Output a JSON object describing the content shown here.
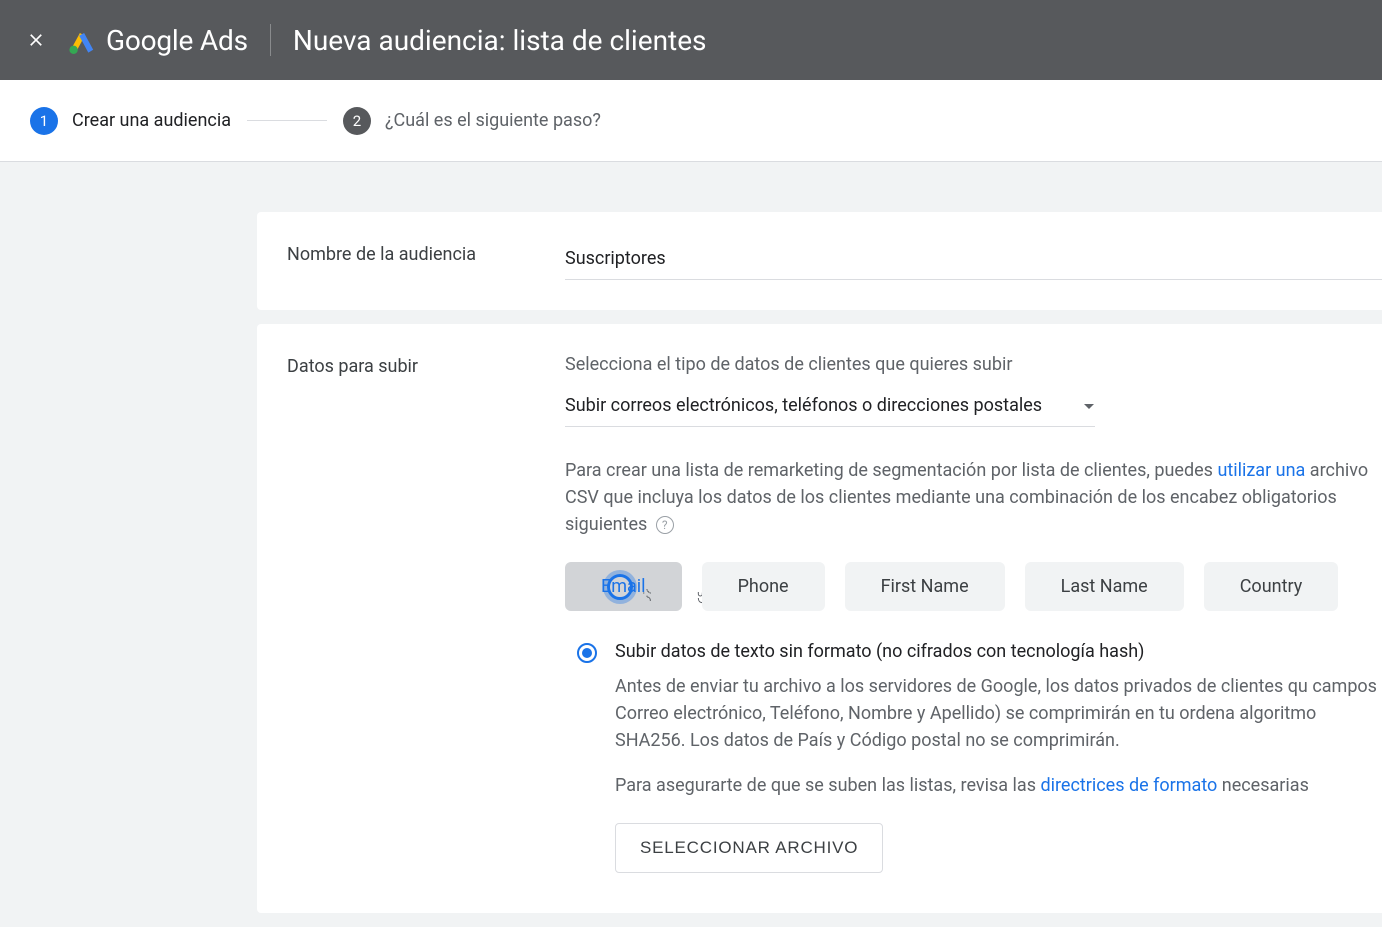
{
  "header": {
    "brand": "Google Ads",
    "title": "Nueva audiencia: lista de clientes"
  },
  "stepper": {
    "step1_num": "1",
    "step1_label": "Crear una audiencia",
    "step2_num": "2",
    "step2_label": "¿Cuál es el siguiente paso?"
  },
  "name_card": {
    "label": "Nombre de la audiencia",
    "value": "Suscriptores"
  },
  "data_card": {
    "label": "Datos para subir",
    "subheading": "Selecciona el tipo de datos de clientes que quieres subir",
    "dropdown": "Subir correos electrónicos, teléfonos o direcciones postales",
    "desc_part1": "Para crear una lista de remarketing de segmentación por lista de clientes, puedes ",
    "desc_link1": "utilizar una",
    "desc_part2": " archivo CSV que incluya los datos de los clientes mediante una combinación de los encabez obligatorios siguientes",
    "chips": [
      "Email",
      "Phone",
      "First Name",
      "Last Name",
      "Country"
    ],
    "radio_label": "Subir datos de texto sin formato (no cifrados con tecnología hash)",
    "radio_desc1": "Antes de enviar tu archivo a los servidores de Google, los datos privados de clientes qu campos Correo electrónico, Teléfono, Nombre y Apellido) se comprimirán en tu ordena algoritmo SHA256. Los datos de País y Código postal no se comprimirán.",
    "radio_desc2a": "Para asegurarte de que se suben las listas, revisa las ",
    "radio_desc2_link": "directrices de formato",
    "radio_desc2b": " necesarias",
    "file_button": "SELECCIONAR ARCHIVO"
  }
}
